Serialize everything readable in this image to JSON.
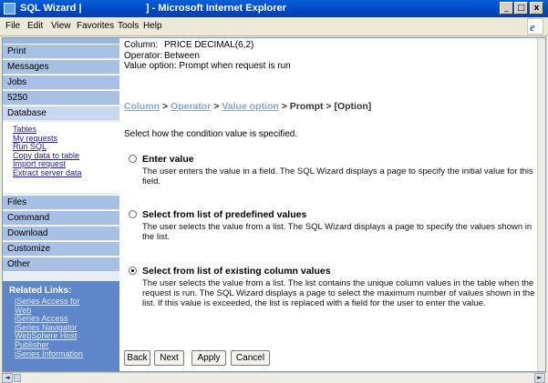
{
  "window": {
    "title": "SQL Wizard |                       ] - Microsoft Internet Explorer",
    "minimize": "_",
    "restore": "□",
    "close": "x"
  },
  "menubar": {
    "file": "File",
    "edit": "Edit",
    "view": "View",
    "favorites": "Favorites",
    "tools": "Tools",
    "help": "Help"
  },
  "sidebar": {
    "items": [
      {
        "label": "Print"
      },
      {
        "label": "Messages"
      },
      {
        "label": "Jobs"
      },
      {
        "label": "5250"
      },
      {
        "label": "Database"
      }
    ],
    "database_links": [
      "Tables",
      "My requests",
      "Run SQL",
      "Copy data to table",
      "Import request",
      "Extract server data"
    ],
    "items_after": [
      {
        "label": "Files"
      },
      {
        "label": "Command"
      },
      {
        "label": "Download"
      },
      {
        "label": "Customize"
      },
      {
        "label": "Other"
      }
    ],
    "related_title": "Related Links:",
    "related_links": [
      "iSeries Access for",
      "Web",
      "iSeries Access",
      "iSeries Navigator",
      "WebSphere Host",
      "Publisher",
      "iSeries Information"
    ]
  },
  "info": {
    "column_label": "Column:",
    "column_value": "PRICE  DECIMAL(6,2)",
    "operator_label": "Operator:",
    "operator_value": "Between",
    "value_option_text": "Value option: Prompt when request is run"
  },
  "breadcrumb": {
    "column": "Column",
    "operator": "Operator",
    "value_option": "Value option",
    "sep": " > ",
    "current": "Prompt > [Option]"
  },
  "intro": "Select how the condition value is specified.",
  "options": [
    {
      "title": "Enter value",
      "description": "The user enters the value in a field. The SQL Wizard displays a page to specify the initial value for this field.",
      "checked": false
    },
    {
      "title": "Select from list of predefined values",
      "description": "The user selects the value from a list. The SQL Wizard displays a page to specify the values shown in the list.",
      "checked": false
    },
    {
      "title": "Select from list of existing column values",
      "description": "The user selects the value from a list. The list contains the unique column values in the table when the request is run. The SQL Wizard displays a page to select the maximum number of values shown in the list. If this value is exceeded, the list is replaced with a field for the user to enter the value.",
      "checked": true
    }
  ],
  "buttons": {
    "back": "Back",
    "next": "Next",
    "apply": "Apply",
    "cancel": "Cancel"
  },
  "scrollbar": {
    "left": "◄",
    "right": "►"
  },
  "colors": {
    "titlebar": "#0047c4",
    "nav": "#a8c0e4",
    "related": "#5f86c8",
    "link": "#1a1ab0",
    "breadcrumb_link": "#8aa4cc"
  }
}
